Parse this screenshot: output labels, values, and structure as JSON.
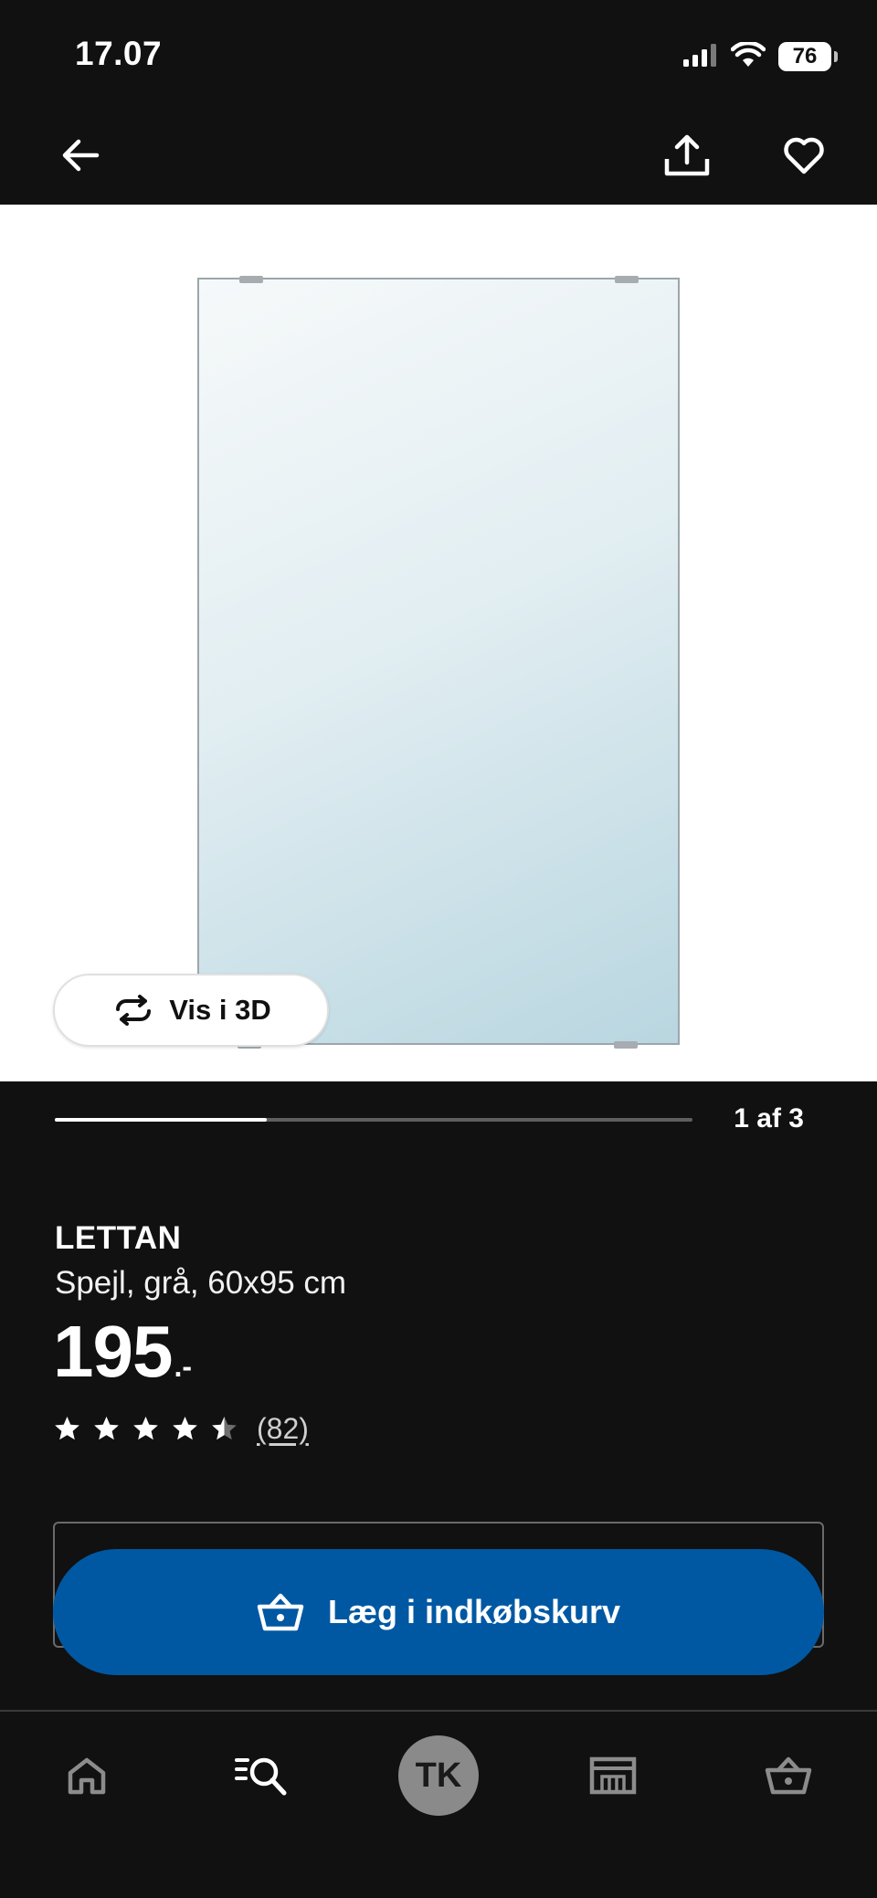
{
  "status_bar": {
    "time": "17.07",
    "battery": "76"
  },
  "top_nav": {
    "icons": [
      "arrow-left-icon",
      "share-icon",
      "heart-icon"
    ]
  },
  "gallery": {
    "view_3d_label": "Vis i 3D",
    "page_counter": "1 af 3",
    "progress_fraction": 0.333
  },
  "product": {
    "name": "LETTAN",
    "description": "Spejl, grå, 60x95 cm",
    "price_integer": "195",
    "price_suffix": ".-",
    "rating_value": 4.5,
    "rating_max": 5,
    "review_count": "(82)"
  },
  "cart": {
    "add_label": "Læg i indkøbskurv",
    "button_color": "#0058a3"
  },
  "bottom_nav": {
    "tabs": [
      "home-icon",
      "search-icon",
      "profile",
      "store-icon",
      "basket-icon"
    ],
    "avatar_initials": "TK"
  }
}
